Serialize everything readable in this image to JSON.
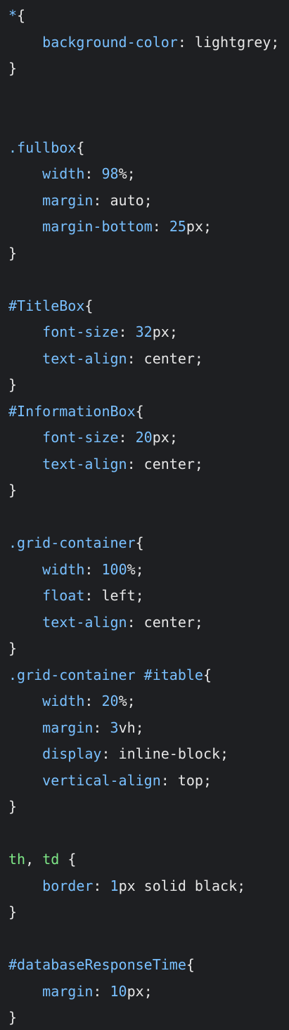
{
  "colors": {
    "background": "#1e1f22",
    "selector": "#79c0ff",
    "element_selector": "#7ee787",
    "property": "#79c0ff",
    "number": "#79c0ff",
    "value": "#e6e6e6",
    "punctuation": "#e6e6e6"
  },
  "code": {
    "lines": [
      [
        {
          "t": "*",
          "k": "selector"
        },
        {
          "t": "{",
          "k": "punctuation"
        }
      ],
      [
        {
          "t": "    ",
          "k": "value"
        },
        {
          "t": "background-color",
          "k": "property"
        },
        {
          "t": ": lightgrey;",
          "k": "value"
        }
      ],
      [
        {
          "t": "}",
          "k": "punctuation"
        }
      ],
      [],
      [],
      [
        {
          "t": ".fullbox",
          "k": "selector"
        },
        {
          "t": "{",
          "k": "punctuation"
        }
      ],
      [
        {
          "t": "    ",
          "k": "value"
        },
        {
          "t": "width",
          "k": "property"
        },
        {
          "t": ": ",
          "k": "value"
        },
        {
          "t": "98",
          "k": "number"
        },
        {
          "t": "%;",
          "k": "value"
        }
      ],
      [
        {
          "t": "    ",
          "k": "value"
        },
        {
          "t": "margin",
          "k": "property"
        },
        {
          "t": ": auto;",
          "k": "value"
        }
      ],
      [
        {
          "t": "    ",
          "k": "value"
        },
        {
          "t": "margin-bottom",
          "k": "property"
        },
        {
          "t": ": ",
          "k": "value"
        },
        {
          "t": "25",
          "k": "number"
        },
        {
          "t": "px;",
          "k": "value"
        }
      ],
      [
        {
          "t": "}",
          "k": "punctuation"
        }
      ],
      [],
      [
        {
          "t": "#TitleBox",
          "k": "selector"
        },
        {
          "t": "{",
          "k": "punctuation"
        }
      ],
      [
        {
          "t": "    ",
          "k": "value"
        },
        {
          "t": "font-size",
          "k": "property"
        },
        {
          "t": ": ",
          "k": "value"
        },
        {
          "t": "32",
          "k": "number"
        },
        {
          "t": "px;",
          "k": "value"
        }
      ],
      [
        {
          "t": "    ",
          "k": "value"
        },
        {
          "t": "text-align",
          "k": "property"
        },
        {
          "t": ": center;",
          "k": "value"
        }
      ],
      [
        {
          "t": "}",
          "k": "punctuation"
        }
      ],
      [
        {
          "t": "#InformationBox",
          "k": "selector"
        },
        {
          "t": "{",
          "k": "punctuation"
        }
      ],
      [
        {
          "t": "    ",
          "k": "value"
        },
        {
          "t": "font-size",
          "k": "property"
        },
        {
          "t": ": ",
          "k": "value"
        },
        {
          "t": "20",
          "k": "number"
        },
        {
          "t": "px;",
          "k": "value"
        }
      ],
      [
        {
          "t": "    ",
          "k": "value"
        },
        {
          "t": "text-align",
          "k": "property"
        },
        {
          "t": ": center;",
          "k": "value"
        }
      ],
      [
        {
          "t": "}",
          "k": "punctuation"
        }
      ],
      [],
      [
        {
          "t": ".grid-container",
          "k": "selector"
        },
        {
          "t": "{",
          "k": "punctuation"
        }
      ],
      [
        {
          "t": "    ",
          "k": "value"
        },
        {
          "t": "width",
          "k": "property"
        },
        {
          "t": ": ",
          "k": "value"
        },
        {
          "t": "100",
          "k": "number"
        },
        {
          "t": "%;",
          "k": "value"
        }
      ],
      [
        {
          "t": "    ",
          "k": "value"
        },
        {
          "t": "float",
          "k": "property"
        },
        {
          "t": ": left;",
          "k": "value"
        }
      ],
      [
        {
          "t": "    ",
          "k": "value"
        },
        {
          "t": "text-align",
          "k": "property"
        },
        {
          "t": ": center;",
          "k": "value"
        }
      ],
      [
        {
          "t": "}",
          "k": "punctuation"
        }
      ],
      [
        {
          "t": ".grid-container #itable",
          "k": "selector"
        },
        {
          "t": "{",
          "k": "punctuation"
        }
      ],
      [
        {
          "t": "    ",
          "k": "value"
        },
        {
          "t": "width",
          "k": "property"
        },
        {
          "t": ": ",
          "k": "value"
        },
        {
          "t": "20",
          "k": "number"
        },
        {
          "t": "%;",
          "k": "value"
        }
      ],
      [
        {
          "t": "    ",
          "k": "value"
        },
        {
          "t": "margin",
          "k": "property"
        },
        {
          "t": ": ",
          "k": "value"
        },
        {
          "t": "3",
          "k": "number"
        },
        {
          "t": "vh;",
          "k": "value"
        }
      ],
      [
        {
          "t": "    ",
          "k": "value"
        },
        {
          "t": "display",
          "k": "property"
        },
        {
          "t": ": inline-block;",
          "k": "value"
        }
      ],
      [
        {
          "t": "    ",
          "k": "value"
        },
        {
          "t": "vertical-align",
          "k": "property"
        },
        {
          "t": ": top;",
          "k": "value"
        }
      ],
      [
        {
          "t": "}",
          "k": "punctuation"
        }
      ],
      [],
      [
        {
          "t": "th",
          "k": "element_selector"
        },
        {
          "t": ", ",
          "k": "punctuation"
        },
        {
          "t": "td",
          "k": "element_selector"
        },
        {
          "t": " {",
          "k": "punctuation"
        }
      ],
      [
        {
          "t": "    ",
          "k": "value"
        },
        {
          "t": "border",
          "k": "property"
        },
        {
          "t": ": ",
          "k": "value"
        },
        {
          "t": "1",
          "k": "number"
        },
        {
          "t": "px solid black;",
          "k": "value"
        }
      ],
      [
        {
          "t": "}",
          "k": "punctuation"
        }
      ],
      [],
      [
        {
          "t": "#databaseResponseTime",
          "k": "selector"
        },
        {
          "t": "{",
          "k": "punctuation"
        }
      ],
      [
        {
          "t": "    ",
          "k": "value"
        },
        {
          "t": "margin",
          "k": "property"
        },
        {
          "t": ": ",
          "k": "value"
        },
        {
          "t": "10",
          "k": "number"
        },
        {
          "t": "px;",
          "k": "value"
        }
      ],
      [
        {
          "t": "}",
          "k": "punctuation"
        }
      ]
    ]
  }
}
